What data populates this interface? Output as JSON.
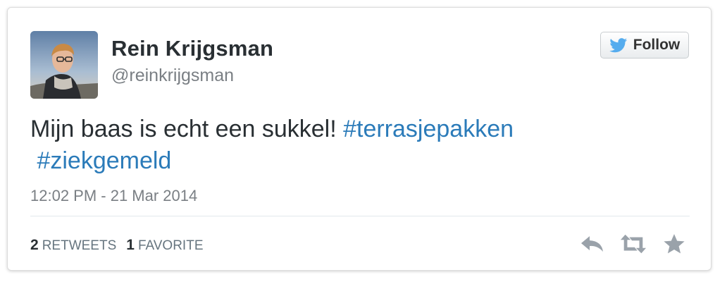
{
  "tweet": {
    "author_name": "Rein Krijgsman",
    "author_handle": "@reinkrijgsman",
    "follow_label": "Follow",
    "text_main": "Mijn baas is echt een sukkel! ",
    "hashtags": [
      "#terrasjepakken",
      "#ziekgemeld"
    ],
    "timestamp": "12:02 PM - 21 Mar 2014",
    "retweets_count": "2",
    "retweets_label": "RETWEETS",
    "favorites_count": "1",
    "favorites_label": "FAVORITE"
  },
  "icons": {
    "follow": "twitter-bird-icon",
    "reply": "reply-icon",
    "retweet": "retweet-icon",
    "favorite": "star-icon"
  },
  "colors": {
    "hashtag": "#2b7bb9",
    "text": "#292f33",
    "muted": "#7a7f84",
    "bird": "#55acee",
    "action_icon": "#9aa2aa"
  }
}
